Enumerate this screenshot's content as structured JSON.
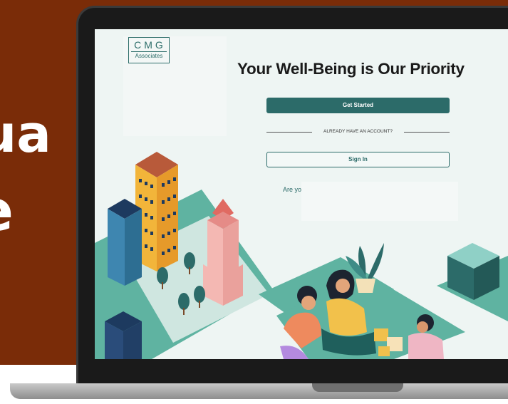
{
  "background_text": {
    "line1": "ua",
    "line2": "e"
  },
  "app": {
    "logo": {
      "mark": "CMG",
      "subtitle": "Associates"
    },
    "headline": "Your Well-Being is Our Priority",
    "get_started_label": "Get Started",
    "divider_label": "ALREADY HAVE AN ACCOUNT?",
    "sign_in_label": "Sign In",
    "question_partial": "Are yo"
  },
  "colors": {
    "brand": "#2c6b69",
    "side_panel": "#7a2c08",
    "screen_bg": "#eef5f3"
  }
}
